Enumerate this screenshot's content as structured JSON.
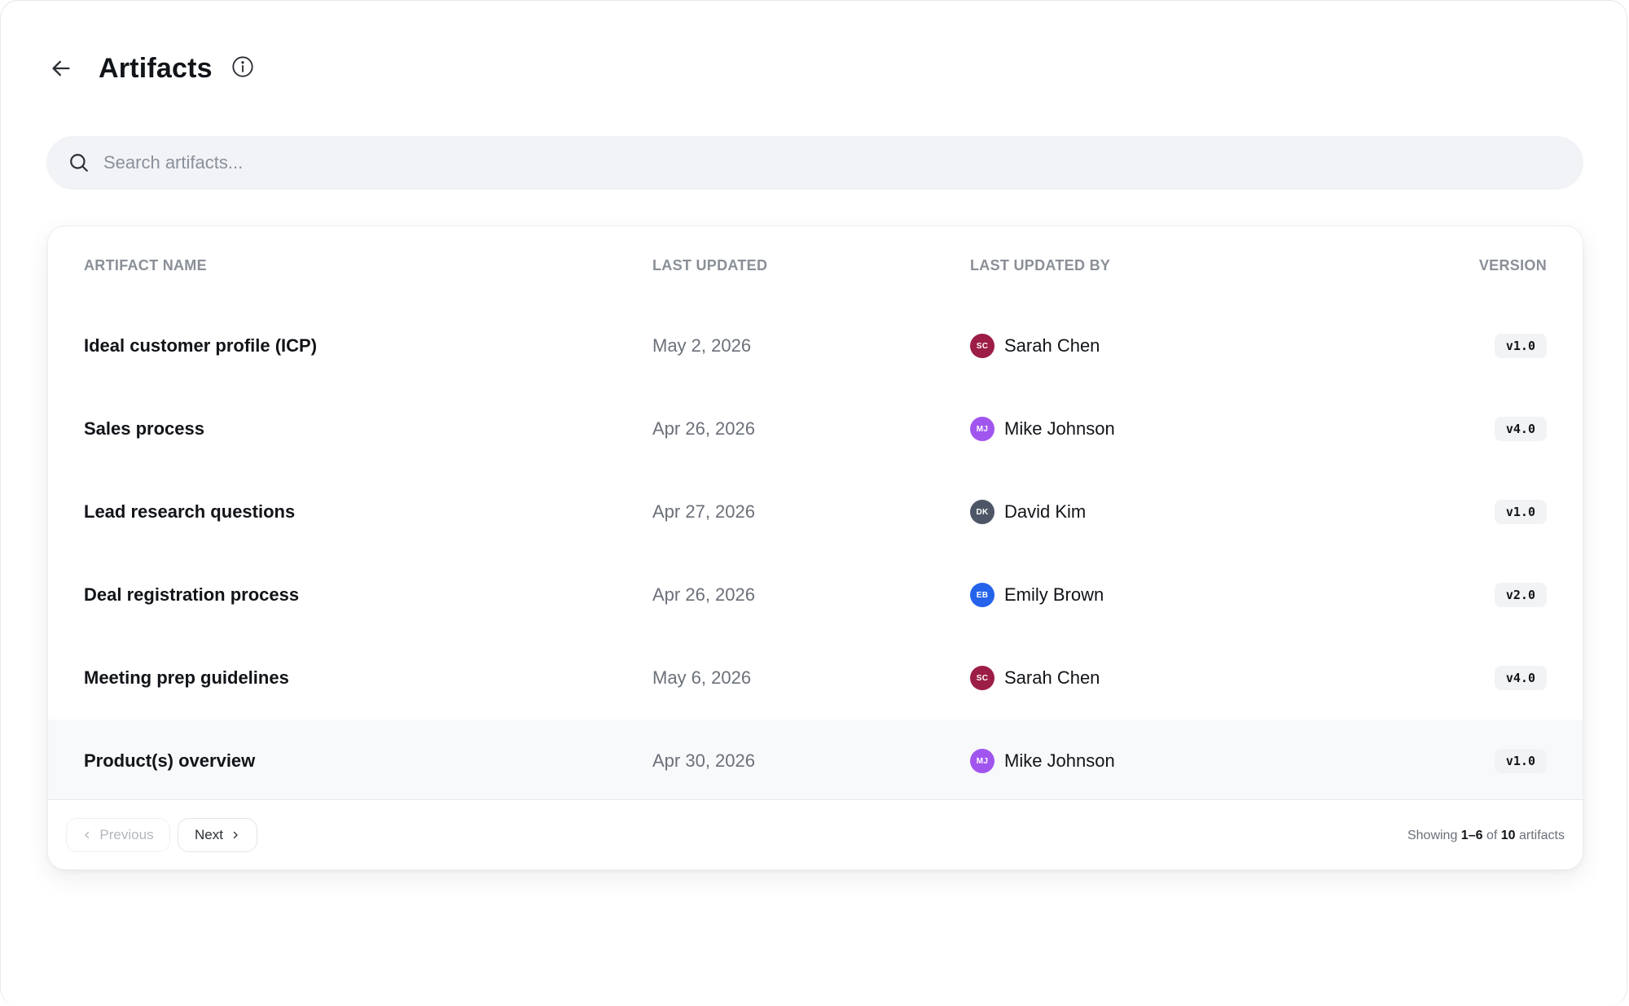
{
  "header": {
    "title": "Artifacts",
    "back_icon": "arrow-left-icon",
    "info_icon": "info-icon"
  },
  "search": {
    "placeholder": "Search artifacts...",
    "value": "",
    "icon": "search-icon"
  },
  "table": {
    "columns": {
      "name": "ARTIFACT NAME",
      "updated": "LAST UPDATED",
      "updated_by": "LAST UPDATED BY",
      "version": "VERSION"
    },
    "rows": [
      {
        "name": "Ideal customer profile (ICP)",
        "updated": "May 2, 2026",
        "user": "Sarah Chen",
        "initials": "SC",
        "avatar_color": "#9c1d46",
        "version": "v1.0"
      },
      {
        "name": "Sales process",
        "updated": "Apr 26, 2026",
        "user": "Mike Johnson",
        "initials": "MJ",
        "avatar_color": "#a155ef",
        "version": "v4.0"
      },
      {
        "name": "Lead research questions",
        "updated": "Apr 27, 2026",
        "user": "David Kim",
        "initials": "DK",
        "avatar_color": "#4d5666",
        "version": "v1.0"
      },
      {
        "name": "Deal registration process",
        "updated": "Apr 26, 2026",
        "user": "Emily Brown",
        "initials": "EB",
        "avatar_color": "#2563eb",
        "version": "v2.0"
      },
      {
        "name": "Meeting prep guidelines",
        "updated": "May 6, 2026",
        "user": "Sarah Chen",
        "initials": "SC",
        "avatar_color": "#9c1d46",
        "version": "v4.0"
      },
      {
        "name": "Product(s) overview",
        "updated": "Apr 30, 2026",
        "user": "Mike Johnson",
        "initials": "MJ",
        "avatar_color": "#a155ef",
        "version": "v1.0"
      }
    ]
  },
  "pagination": {
    "previous_label": "Previous",
    "next_label": "Next",
    "summary_prefix": "Showing ",
    "summary_range": "1–6",
    "summary_of": " of ",
    "summary_total": "10",
    "summary_suffix": " artifacts"
  }
}
